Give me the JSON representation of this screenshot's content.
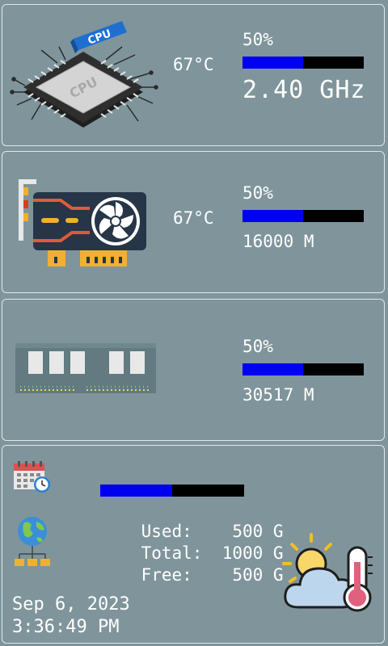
{
  "cpu": {
    "temperature": "67°C",
    "usage": "50%",
    "usage_fraction": 0.5,
    "frequency": "2.40 GHz",
    "chip_label": "CPU",
    "tag_label": "CPU"
  },
  "gpu": {
    "temperature": "67°C",
    "usage": "50%",
    "usage_fraction": 0.5,
    "memory": "16000 M"
  },
  "ram": {
    "usage": "50%",
    "usage_fraction": 0.5,
    "memory": "30517 M"
  },
  "disk": {
    "usage_fraction": 0.5,
    "used_label": "Used:",
    "used_value": "500 G",
    "total_label": "Total:",
    "total_value": "1000 G",
    "free_label": "Free:",
    "free_value": "500 G"
  },
  "clock": {
    "date": "Sep 6, 2023",
    "time": "3:36:49 PM"
  },
  "icons": {
    "cpu": "cpu-chip-icon",
    "gpu": "graphics-card-icon",
    "ram": "ram-module-icon",
    "calendar": "calendar-clock-icon",
    "network": "network-globe-icon",
    "weather": "weather-thermometer-icon"
  },
  "colors": {
    "background": "#7f959b",
    "bar_fill": "#0000f0",
    "bar_track": "#000000",
    "text": "#ffffff"
  }
}
